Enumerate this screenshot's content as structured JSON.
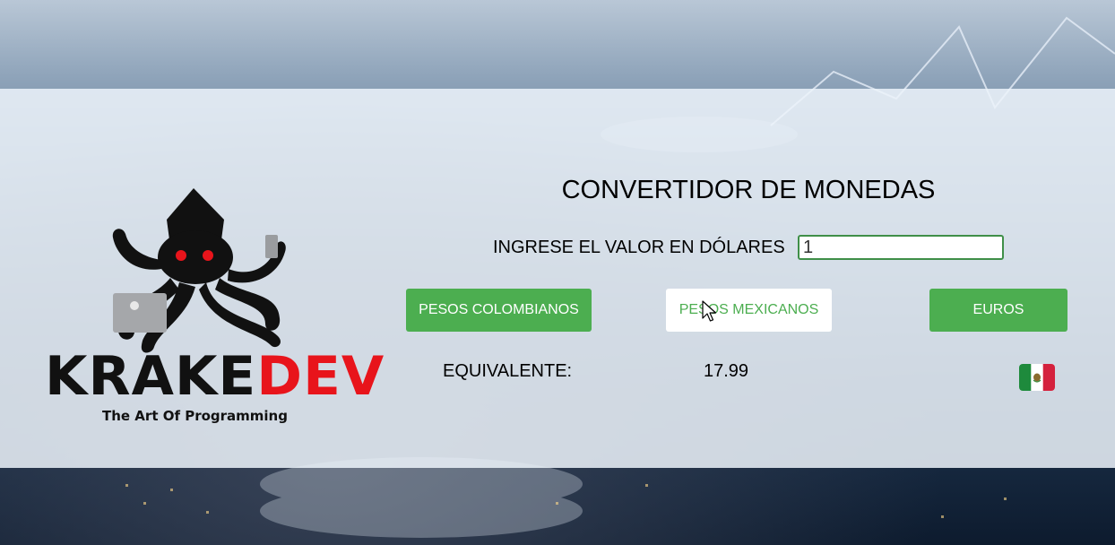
{
  "app": {
    "title": "CONVERTIDOR DE MONEDAS"
  },
  "logo": {
    "brand_part1": "KRAKE",
    "brand_part2": "DEV",
    "tagline": "The Art Of Programming",
    "colors": {
      "dark": "#111111",
      "accent": "#e8141b"
    }
  },
  "form": {
    "input_label": "INGRESE EL VALOR EN DÓLARES",
    "input_value": "1"
  },
  "buttons": {
    "colombian": "PESOS COLOMBIANOS",
    "mexican": "PESOS MEXICANOS",
    "euros": "EUROS"
  },
  "result": {
    "label": "EQUIVALENTE:",
    "value": "17.99",
    "flag_icon": "mexico-flag-icon"
  },
  "colors": {
    "button_green": "#4cae50",
    "input_border": "#3f8f48"
  }
}
